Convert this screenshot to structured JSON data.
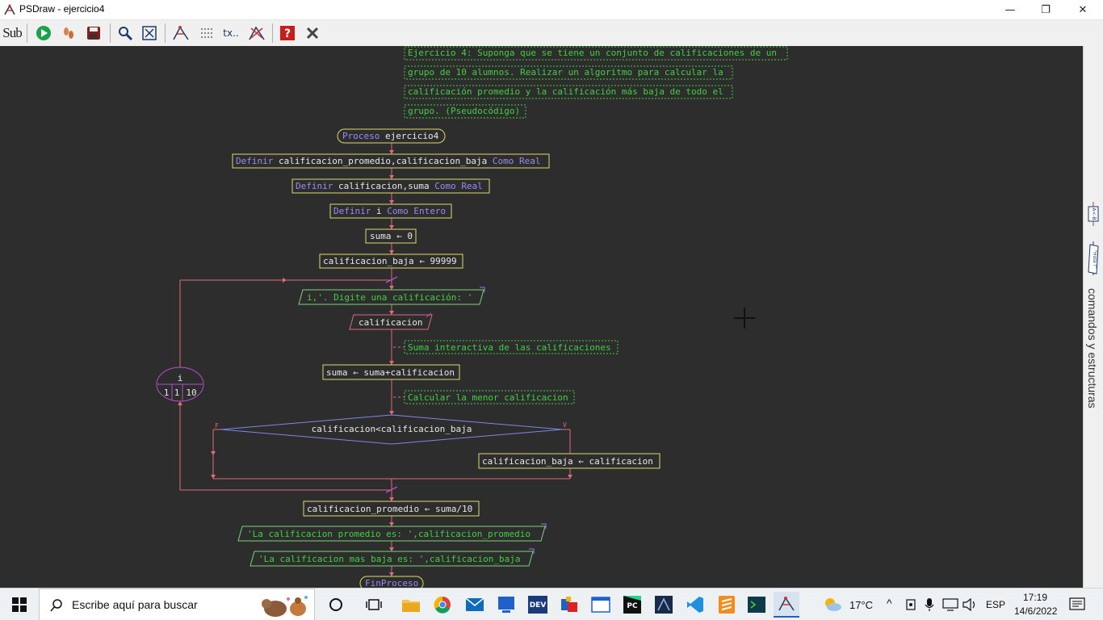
{
  "window": {
    "title": "PSDraw - ejercicio4",
    "minimize_glyph": "—",
    "maximize_glyph": "❐",
    "close_glyph": "✕"
  },
  "toolbar": {
    "sub_label": "Sub",
    "text_tool_label": "tx.."
  },
  "side_panel": {
    "label": "comandos y estructuras",
    "tab1": "A<-B",
    "tab2": "\"Hola !\""
  },
  "colors": {
    "canvas_bg": "#2d2d2d",
    "process_border": "#e0d96a",
    "flow_line": "#e06b7a",
    "io_border": "#7ad37a",
    "decision_border": "#7f86e8",
    "loop_border": "#b44fc9",
    "comment_green": "#3fd13f",
    "keyword": "#9a8cf0"
  },
  "flow": {
    "comment_lines": [
      "Ejercicio 4: Suponga que se tiene un conjunto de calificaciones de un",
      "grupo de 10 alumnos. Realizar un algoritmo para calcular la",
      "calificación promedio y la calificación más baja de todo el",
      "grupo. (Pseudocódigo)"
    ],
    "proceso_kw": "Proceso",
    "proceso_name": " ejercicio4",
    "def1_kw": "Definir",
    "def1_vars": " calificacion_promedio,calificacion_baja",
    "def1_type": " Como Real",
    "def2_kw": "Definir",
    "def2_vars": " calificacion,suma",
    "def2_type": " Como Real",
    "def3_kw": "Definir",
    "def3_vars": " i",
    "def3_type": " Como Entero",
    "assign_suma": "suma ← 0",
    "assign_baja": "calificacion_baja ← 99999",
    "escribir_prompt": "i,'. Digite una calificación: '",
    "leer_var": "calificacion",
    "comment_suma": "Suma interactiva de las calificaciones",
    "assign_acum": "suma ← suma+calificacion",
    "comment_menor": "Calcular la menor calificacion",
    "decision": "calificacion<calificacion_baja",
    "decision_false": "F",
    "decision_true": "V",
    "assign_min": "calificacion_baja ← calificacion",
    "loop_var": "i",
    "loop_from": "1",
    "loop_step": "1",
    "loop_to": "10",
    "assign_prom": "calificacion_promedio ← suma/10",
    "out_prom": "'La calificacion promedio es: ',calificacion_promedio",
    "out_baja": "'La calificacion mas baja es: ',calificacion_baja",
    "fin": "FinProceso"
  },
  "taskbar": {
    "search_placeholder": "Escribe aquí para buscar",
    "weather": "17°C",
    "language": "ESP",
    "time": "17:19",
    "date": "14/6/2022"
  }
}
